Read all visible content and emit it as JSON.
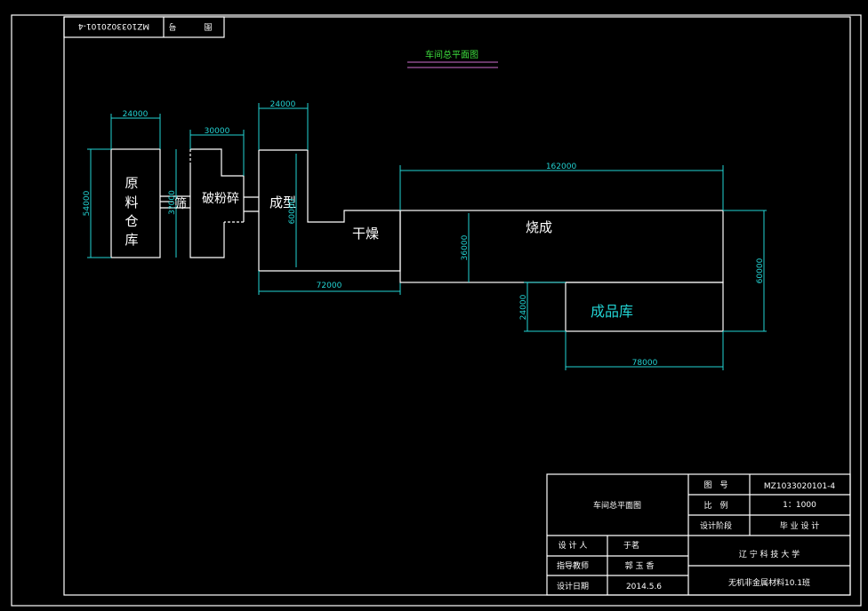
{
  "stamp": {
    "number": "MZ1033020101-4",
    "label_a": "号",
    "label_b": "图"
  },
  "drawing_title": "车间总平面图",
  "areas": {
    "raw": [
      "原",
      "料",
      "仓",
      "库"
    ],
    "screen": "筛",
    "crush": "破粉碎",
    "forming": "成型",
    "drying": "干燥",
    "firing": "烧成",
    "product": "成品库"
  },
  "dims": {
    "raw_w": "24000",
    "raw_h": "54000",
    "crush_w": "30000",
    "screen_h": "3?000",
    "form_w": "24000",
    "form_h": "60000",
    "form_dry_len": "72000",
    "firing_len": "162000",
    "firing_h": "36000",
    "total_h": "60000",
    "product_h": "24000",
    "product_w": "78000"
  },
  "title_block": {
    "name": "车间总平面图",
    "drawing_no_label": "图　号",
    "drawing_no": "MZ1033020101-4",
    "scale_label": "比　例",
    "scale": "1：1000",
    "stage_label": "设计阶段",
    "stage": "毕 业 设 计",
    "designer_label": "设 计 人",
    "designer": "于茗",
    "advisor_label": "指导教师",
    "advisor": "郭 玉 香",
    "date_label": "设计日期",
    "date": "2014.5.6",
    "school": "辽 宁 科 技 大 学",
    "class": "无机非金属材料10.1班"
  }
}
